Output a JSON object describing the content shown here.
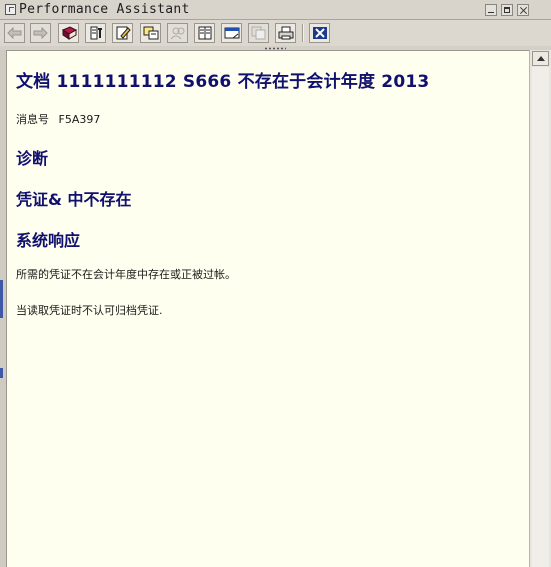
{
  "window": {
    "title": "Performance Assistant"
  },
  "toolbar": {
    "buttons": [
      {
        "icon": "back-arrow-icon",
        "enabled": false
      },
      {
        "icon": "forward-arrow-icon",
        "enabled": false
      },
      {
        "icon": "book-icon",
        "enabled": true
      },
      {
        "icon": "technical-info-icon",
        "enabled": true
      },
      {
        "icon": "edit-note-icon",
        "enabled": true
      },
      {
        "icon": "glossary-icon",
        "enabled": true
      },
      {
        "icon": "people-icon",
        "enabled": false
      },
      {
        "icon": "table-of-contents-icon",
        "enabled": true
      },
      {
        "icon": "window-icon",
        "enabled": true
      },
      {
        "icon": "copy-icon",
        "enabled": false
      },
      {
        "icon": "print-icon",
        "enabled": true
      },
      {
        "icon": "close-x-icon",
        "enabled": true
      }
    ]
  },
  "document": {
    "title": "文档  1111111112 S666 不存在于会计年度  2013",
    "message_label": "消息号",
    "message_number": "F5A397",
    "diagnosis_heading": "诊断",
    "diagnosis_text": "凭证& 中不存在",
    "response_heading": "系统响应",
    "paragraphs": [
      "所需的凭证不在会计年度中存在或正被过帐。",
      "当读取凭证时不认可归档凭证."
    ]
  },
  "colors": {
    "heading": "#10106e",
    "content_background": "#ffffef",
    "chrome": "#d4d0c8",
    "close_button_accent": "#1a3a8a"
  }
}
